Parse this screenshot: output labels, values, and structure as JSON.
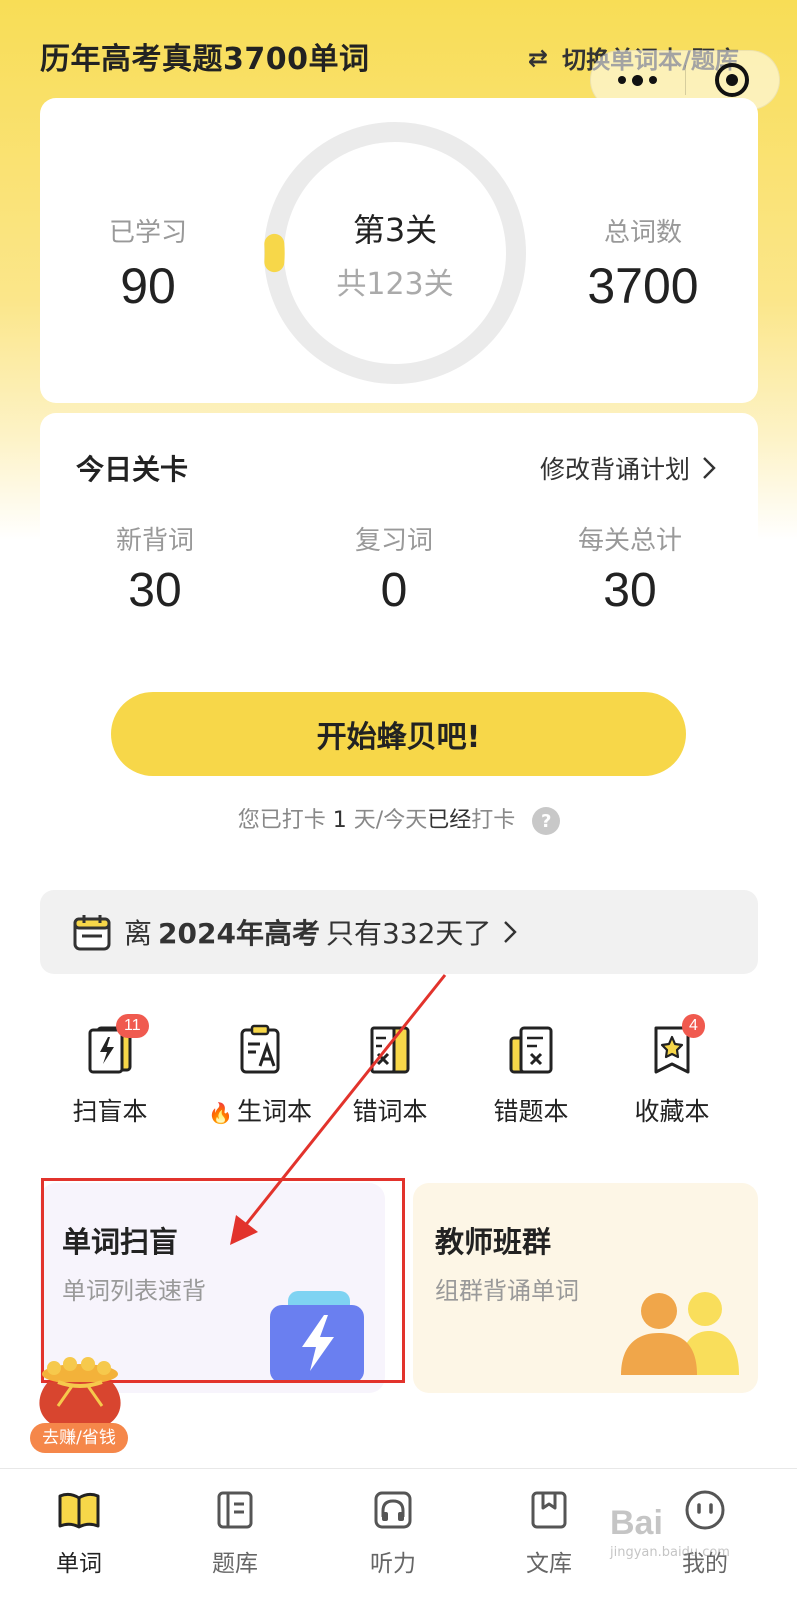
{
  "header": {
    "title": "历年高考真题3700单词",
    "switch_label": "切换单词本/题库",
    "switch_icon": "swap-arrows-icon"
  },
  "progress": {
    "learned_label": "已学习",
    "learned_value": "90",
    "total_label": "总词数",
    "total_value": "3700",
    "level": "第3关",
    "level_total": "共123关",
    "ring_fraction": 0.024,
    "ring_color": "#f7d749"
  },
  "today": {
    "title": "今日关卡",
    "edit_plan": "修改背诵计划",
    "stats": [
      {
        "label": "新背词",
        "value": "30"
      },
      {
        "label": "复习词",
        "value": "0"
      },
      {
        "label": "每关总计",
        "value": "30"
      }
    ],
    "start_button": "开始蜂贝吧!",
    "checkin_prefix": "您已打卡",
    "checkin_days": "1",
    "checkin_mid": "天/今天",
    "checkin_done": "已经",
    "checkin_suffix": "打卡",
    "help": "?"
  },
  "countdown": {
    "prefix": "离",
    "bold": "2024年高考",
    "suffix": "只有332天了"
  },
  "tools": [
    {
      "label": "扫盲本",
      "icon": "flash-book-icon",
      "badge": "11"
    },
    {
      "label": "生词本",
      "icon": "word-card-icon",
      "badge": "",
      "fire": "🔥"
    },
    {
      "label": "错词本",
      "icon": "wrong-word-book-icon",
      "badge": ""
    },
    {
      "label": "错题本",
      "icon": "wrong-question-book-icon",
      "badge": ""
    },
    {
      "label": "收藏本",
      "icon": "star-bookmark-icon",
      "badge": "4"
    }
  ],
  "features": [
    {
      "title": "单词扫盲",
      "subtitle": "单词列表速背",
      "icon": "flash-card-icon"
    },
    {
      "title": "教师班群",
      "subtitle": "组群背诵单词",
      "icon": "group-people-icon"
    }
  ],
  "gift": {
    "label": "去赚/省钱"
  },
  "nav": [
    {
      "label": "单词",
      "icon": "book-open-icon",
      "active": true
    },
    {
      "label": "题库",
      "icon": "question-bank-icon"
    },
    {
      "label": "听力",
      "icon": "headphones-icon"
    },
    {
      "label": "文库",
      "icon": "library-icon"
    },
    {
      "label": "我的",
      "icon": "profile-face-icon"
    }
  ],
  "watermark": {
    "line1": "Bai",
    "line2": "jingyan.baidu.com"
  },
  "colors": {
    "accent": "#f7d749",
    "badge": "#f05a4f",
    "annotation": "#e2332c"
  }
}
